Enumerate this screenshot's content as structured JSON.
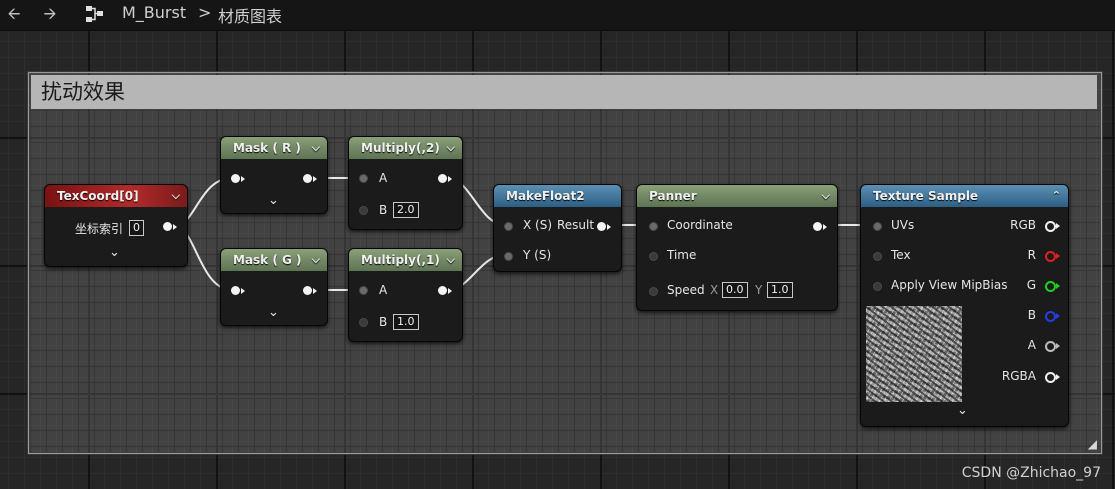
{
  "topbar": {
    "back_icon": "arrow-left-icon",
    "forward_icon": "arrow-right-icon",
    "graph_icon": "node-graph-icon",
    "asset_name": "M_Burst",
    "separator": ">",
    "graph_name": "材质图表"
  },
  "comment": {
    "title": "扰动效果"
  },
  "nodes": {
    "texcoord": {
      "title": "TexCoord[0]",
      "param_label": "坐标索引",
      "param_value": "0"
    },
    "mask_r": {
      "title": "Mask ( R )"
    },
    "mask_g": {
      "title": "Mask ( G )"
    },
    "multiply_2": {
      "title": "Multiply(,2)",
      "pin_a": "A",
      "pin_b": "B",
      "b_value": "2.0"
    },
    "multiply_1": {
      "title": "Multiply(,1)",
      "pin_a": "A",
      "pin_b": "B",
      "b_value": "1.0"
    },
    "makefloat2": {
      "title": "MakeFloat2",
      "pin_x": "X (S)",
      "pin_y": "Y (S)",
      "out": "Result"
    },
    "panner": {
      "title": "Panner",
      "pin_coordinate": "Coordinate",
      "pin_time": "Time",
      "pin_speed": "Speed",
      "speed_x_label": "X",
      "speed_x": "0.0",
      "speed_y_label": "Y",
      "speed_y": "1.0"
    },
    "texture_sample": {
      "title": "Texture Sample",
      "in_uvs": "UVs",
      "in_tex": "Tex",
      "in_mip": "Apply View MipBias",
      "out_rgb": "RGB",
      "out_r": "R",
      "out_g": "G",
      "out_b": "B",
      "out_a": "A",
      "out_rgba": "RGBA"
    }
  },
  "colors": {
    "header_red": "#b22a2a",
    "header_green": "#6f8763",
    "header_blue": "#3f7399",
    "pin_r": "#e02020",
    "pin_g": "#20d020",
    "pin_b": "#2040e0"
  },
  "watermark": "CSDN @Zhichao_97"
}
